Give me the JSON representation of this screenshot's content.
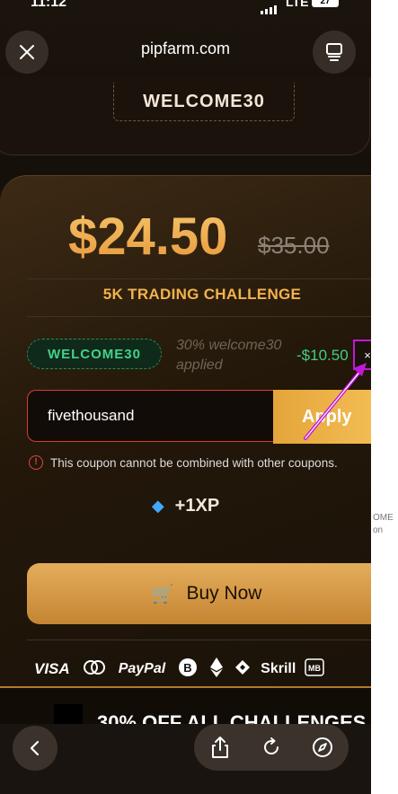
{
  "status_bar": {
    "time": "11:12",
    "network": "LTE",
    "battery": "27"
  },
  "browser": {
    "site": "pipfarm.com"
  },
  "promo_code_top": "WELCOME30",
  "card": {
    "price": "$24.50",
    "original_price": "$35.00",
    "challenge_name": "5K TRADING CHALLENGE",
    "applied_coupon": {
      "code": "WELCOME30",
      "description": "30% welcome30 applied",
      "discount": "-$10.50",
      "remove_label": "×"
    },
    "coupon_input": {
      "value": "fivethousand",
      "placeholder": ""
    },
    "apply_label": "Apply",
    "error_message": "This coupon cannot be combined with other coupons.",
    "xp_reward": "+1XP",
    "buy_label": "Buy Now",
    "payment_methods": [
      "VISA",
      "PayPal",
      "Skrill"
    ]
  },
  "promo_banner": "30% OFF ALL CHALLENGES",
  "annotation_color": "#c317d8",
  "icons": [
    "close-icon",
    "tabs-icon",
    "error-icon",
    "gem-icon",
    "cart-icon",
    "back-icon",
    "share-icon",
    "reload-icon",
    "compass-icon"
  ]
}
